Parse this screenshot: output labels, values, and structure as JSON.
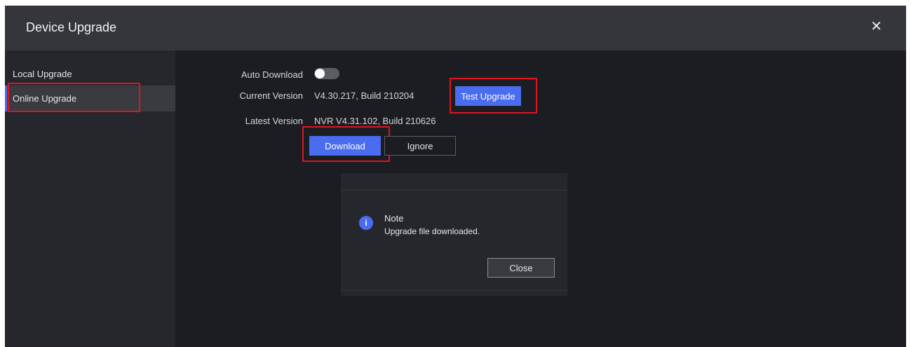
{
  "window": {
    "title": "Device Upgrade",
    "close_glyph": "✕"
  },
  "sidebar": {
    "items": [
      {
        "label": "Local Upgrade",
        "selected": false
      },
      {
        "label": "Online Upgrade",
        "selected": true
      }
    ]
  },
  "form": {
    "auto_download_label": "Auto Download",
    "auto_download_on": false,
    "current_version_label": "Current Version",
    "current_version_value": "V4.30.217, Build 210204",
    "test_upgrade_label": "Test Upgrade",
    "latest_version_label": "Latest Version",
    "latest_version_value": "NVR V4.31.102, Build 210626",
    "download_label": "Download",
    "ignore_label": "Ignore"
  },
  "dialog": {
    "icon": "info-icon",
    "icon_glyph": "i",
    "title": "Note",
    "message": "Upgrade file downloaded.",
    "close_label": "Close"
  },
  "colors": {
    "accent": "#4a6cf0",
    "highlight_box": "#e0141e",
    "background": "#1c1d22",
    "titlebar": "#34363c"
  }
}
